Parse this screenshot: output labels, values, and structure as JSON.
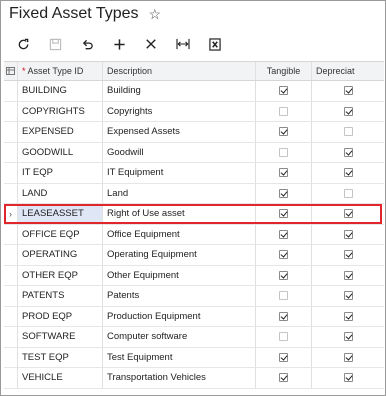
{
  "page": {
    "title": "Fixed Asset Types",
    "star_icon": "star-icon"
  },
  "toolbar": [
    {
      "name": "refresh-icon",
      "disabled": false
    },
    {
      "name": "save-icon",
      "disabled": true
    },
    {
      "name": "undo-icon",
      "disabled": false
    },
    {
      "name": "add-icon",
      "disabled": false
    },
    {
      "name": "delete-icon",
      "disabled": false
    },
    {
      "name": "fit-columns-icon",
      "disabled": false
    },
    {
      "name": "export-excel-icon",
      "disabled": false
    }
  ],
  "grid": {
    "headers": {
      "asset_type_id": "Asset Type ID",
      "required_mark": "*",
      "description": "Description",
      "tangible": "Tangible",
      "depreciable": "Depreciat"
    },
    "rows": [
      {
        "id": "BUILDING",
        "description": "Building",
        "tangible": true,
        "depreciable": true
      },
      {
        "id": "COPYRIGHTS",
        "description": "Copyrights",
        "tangible": false,
        "depreciable": true
      },
      {
        "id": "EXPENSED",
        "description": "Expensed Assets",
        "tangible": true,
        "depreciable": false
      },
      {
        "id": "GOODWILL",
        "description": "Goodwill",
        "tangible": false,
        "depreciable": true
      },
      {
        "id": "IT EQP",
        "description": "IT Equipment",
        "tangible": true,
        "depreciable": true
      },
      {
        "id": "LAND",
        "description": "Land",
        "tangible": true,
        "depreciable": false
      },
      {
        "id": "LEASEASSET",
        "description": "Right of Use asset",
        "tangible": true,
        "depreciable": true,
        "selected": true
      },
      {
        "id": "OFFICE EQP",
        "description": "Office Equipment",
        "tangible": true,
        "depreciable": true
      },
      {
        "id": "OPERATING",
        "description": "Operating Equipment",
        "tangible": true,
        "depreciable": true
      },
      {
        "id": "OTHER EQP",
        "description": "Other Equipment",
        "tangible": true,
        "depreciable": true
      },
      {
        "id": "PATENTS",
        "description": "Patents",
        "tangible": false,
        "depreciable": true
      },
      {
        "id": "PROD EQP",
        "description": "Production Equipment",
        "tangible": true,
        "depreciable": true
      },
      {
        "id": "SOFTWARE",
        "description": "Computer software",
        "tangible": false,
        "depreciable": true
      },
      {
        "id": "TEST EQP",
        "description": "Test Equipment",
        "tangible": true,
        "depreciable": true
      },
      {
        "id": "VEHICLE",
        "description": "Transportation Vehicles",
        "tangible": true,
        "depreciable": true
      }
    ]
  },
  "colors": {
    "highlight": "#e0262b",
    "selected_cell": "#dfe6f6",
    "header_bg": "#f2f3f5"
  }
}
